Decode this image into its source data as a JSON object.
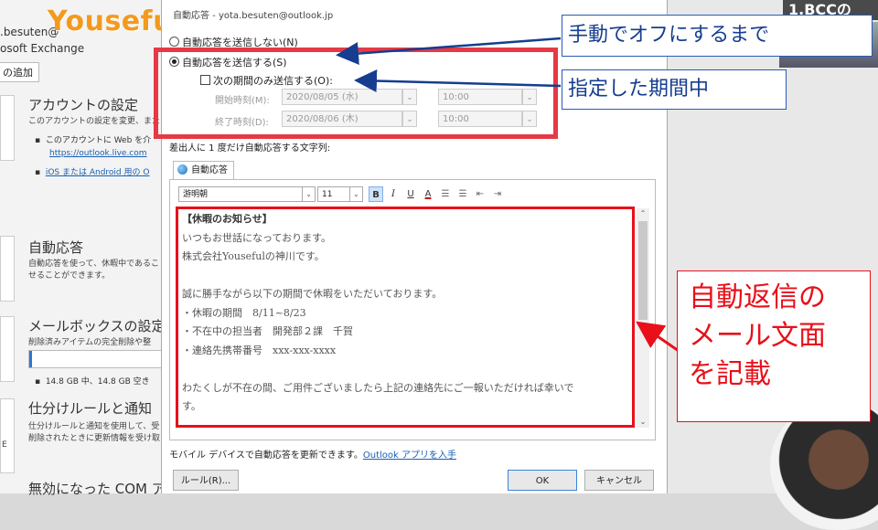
{
  "background": {
    "logo": "Youseful",
    "account_email": ".besuten@",
    "account_type": "osoft Exchange",
    "add_account": "の追加",
    "account_settings": {
      "title": "アカウントの設定",
      "desc": "このアカウントの設定を変更、また",
      "bullet1": "このアカウントに Web を介",
      "link1": "https://outlook.live.com",
      "link2": "iOS または Android 用の O"
    },
    "auto_reply": {
      "title": "自動応答",
      "desc1": "自動応答を使って、休暇中であるこ",
      "desc2": "せることができます。"
    },
    "mailbox": {
      "title": "メールボックスの設定",
      "desc": "削除済みアイテムの完全削除や整",
      "quota": "14.8 GB 中、14.8 GB 空き",
      "quota_fraction": 0.02
    },
    "rules": {
      "title": "仕分けルールと通知",
      "desc1": "仕分けルールと通知を使用して、受",
      "desc2": "削除されたときに更新情報を受け取",
      "side_letters": "E"
    },
    "com": {
      "title": "無効になった COM ア"
    },
    "right_banner": "1.BCCの"
  },
  "dialog": {
    "title": "自動応答 - yota.besuten@outlook.jp",
    "radio_off": "自動応答を送信しない(N)",
    "radio_on": "自動応答を送信する(S)",
    "checkbox_label": "次の期間のみ送信する(O):",
    "start_label": "開始時刻(M):",
    "start_date": "2020/08/05 (水)",
    "start_time": "10:00",
    "end_label": "終了時刻(D):",
    "end_date": "2020/08/06 (木)",
    "end_time": "10:00",
    "sender_label": "差出人に 1 度だけ自動応答する文字列:",
    "tab_label": "自動応答",
    "font_name": "游明朝",
    "font_size": "11",
    "format_buttons": [
      "B",
      "I",
      "U",
      "A",
      "☰",
      "☰",
      "⇤",
      "⇥"
    ],
    "body_lines": [
      "【休暇のお知らせ】",
      "いつもお世話になっております。",
      "株式会社Yousefulの神川です。",
      "",
      "誠に勝手ながら以下の期間で休暇をいただいております。",
      "・休暇の期間　8/11~8/23",
      "・不在中の担当者　開発部２課　千賀",
      "・連絡先携帯番号　xxx-xxx-xxxx",
      "",
      "わたくしが不在の間、ご用件ございましたら上記の連絡先にご一報いただければ幸いで",
      "す。"
    ],
    "mobile_note": "モバイル デバイスで自動応答を更新できます。",
    "mobile_link": "Outlook アプリを入手",
    "rules_button": "ルール(R)...",
    "ok_button": "OK",
    "cancel_button": "キャンセル"
  },
  "annotations": {
    "callout_manual": "手動でオフにするまで",
    "callout_period": "指定した期間中",
    "callout_body": [
      "自動返信の",
      "メール文面",
      "を記載"
    ]
  }
}
